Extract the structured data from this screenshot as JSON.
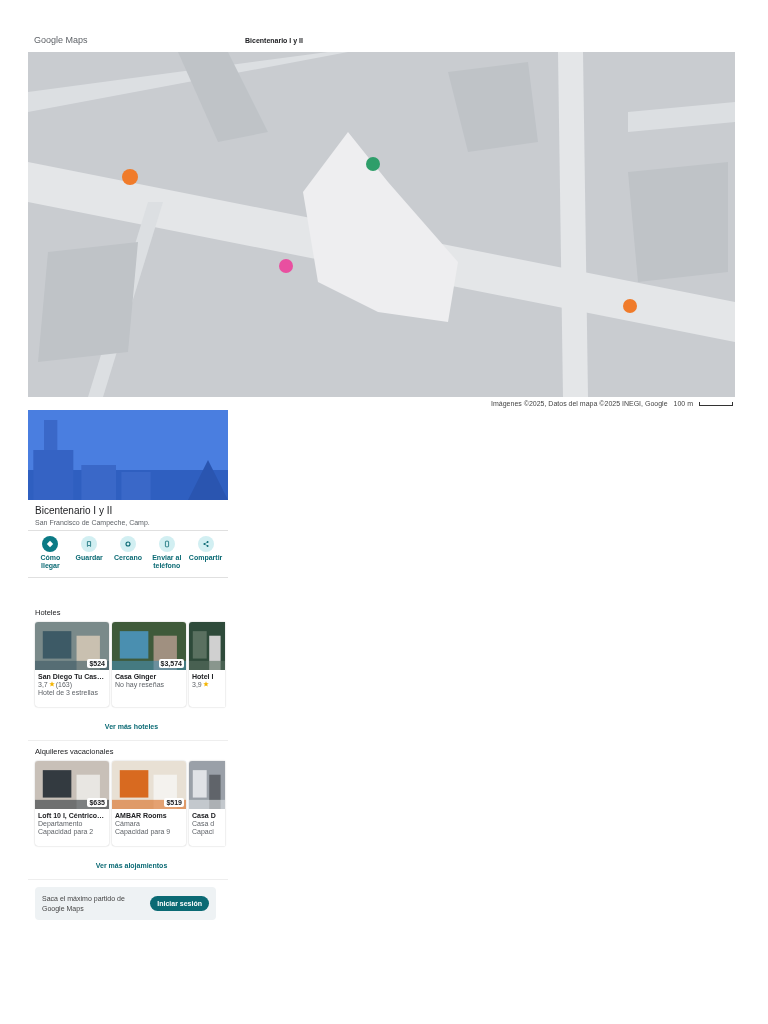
{
  "header": {
    "logo": "Google Maps",
    "title": "Bicentenario I y II"
  },
  "map": {
    "kind": "picture",
    "attribution": "Imágenes ©2025, Datos del mapa ©2025 INEGI, Google",
    "scale": "100 m"
  },
  "place": {
    "name": "Bicentenario I y II",
    "address": "San Francisco de Campeche, Camp.",
    "actions": [
      {
        "label": "Cómo llegar",
        "kind": "directions",
        "primary": true
      },
      {
        "label": "Guardar",
        "kind": "save",
        "primary": false
      },
      {
        "label": "Cercano",
        "kind": "nearby",
        "primary": false
      },
      {
        "label": "Enviar al teléfono",
        "kind": "phone",
        "primary": false
      },
      {
        "label": "Compartir",
        "kind": "share",
        "primary": false
      }
    ]
  },
  "hotels": {
    "title": "Hoteles",
    "items": [
      {
        "name": "San Diego Tu Cas…",
        "price": "$524",
        "rating": "3,7",
        "reviews": "(163)",
        "lines": [
          "Hotel de 3 estrellas"
        ]
      },
      {
        "name": "Casa Ginger",
        "price": "$3,574",
        "lines": [
          "No hay reseñas"
        ]
      },
      {
        "name": "Hotel I",
        "rating": "3,9"
      }
    ],
    "more": "Ver más hoteles"
  },
  "rentals": {
    "title": "Alquileres vacacionales",
    "items": [
      {
        "name": "Loft 10 I, Céntrico…",
        "price": "$635",
        "lines": [
          "Departamento",
          "Capacidad para 2"
        ]
      },
      {
        "name": "AMBAR Rooms",
        "price": "$519",
        "lines": [
          "Cámara",
          "Capacidad para 9"
        ]
      },
      {
        "name": "Casa D",
        "lines": [
          "Casa d",
          "Capaci"
        ]
      }
    ],
    "more": "Ver más alojamientos"
  },
  "signin": {
    "text": "Saca el máximo partido de Google Maps",
    "button": "Iniciar sesión"
  }
}
